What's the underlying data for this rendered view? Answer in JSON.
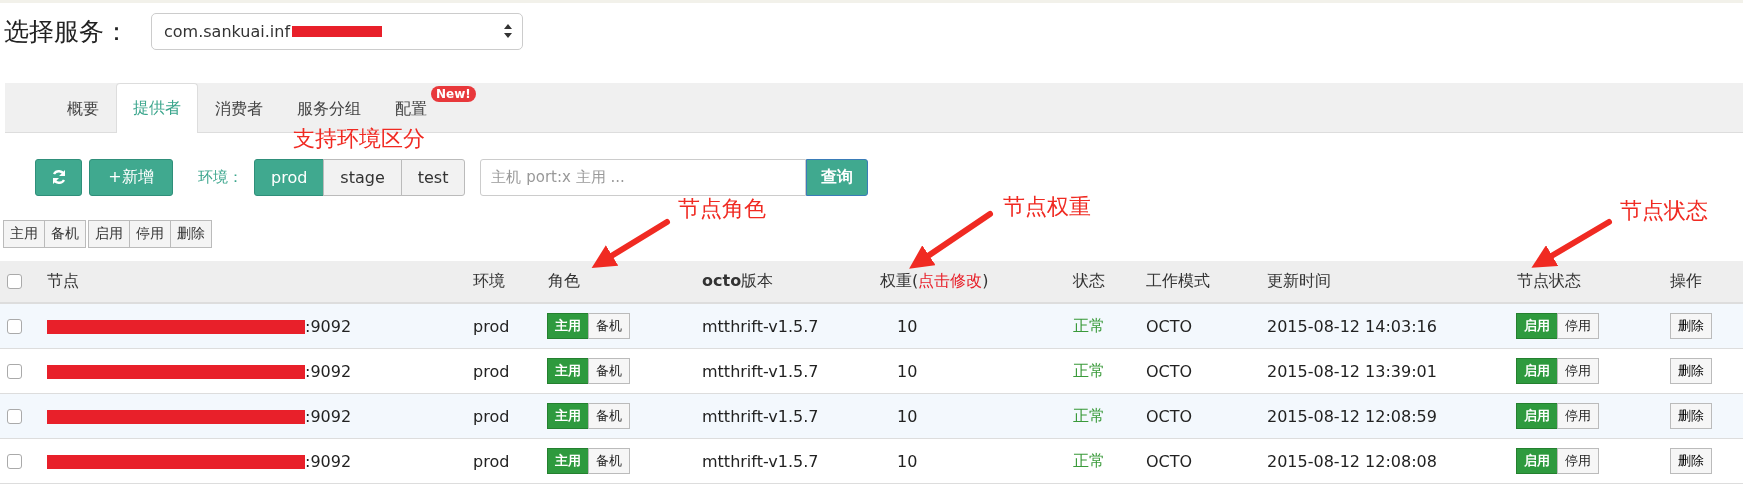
{
  "service_picker": {
    "label": "选择服务：",
    "value": "com.sankuai.inf",
    "redacted": true
  },
  "tabs": [
    {
      "label": "概要",
      "selected": false
    },
    {
      "label": "提供者",
      "selected": true
    },
    {
      "label": "消费者",
      "selected": false
    },
    {
      "label": "服务分组",
      "selected": false
    },
    {
      "label": "配置",
      "selected": false,
      "badge": "New!"
    }
  ],
  "toolbar": {
    "add_label": "+新增",
    "env_label": "环境：",
    "envs": [
      {
        "label": "prod",
        "selected": true
      },
      {
        "label": "stage",
        "selected": false
      },
      {
        "label": "test",
        "selected": false
      }
    ],
    "search": {
      "placeholder": "主机 port:x 主用 ..."
    },
    "query_button": "查询"
  },
  "batch_groups": [
    {
      "buttons": [
        "主用",
        "备机"
      ]
    },
    {
      "buttons": [
        "启用",
        "停用",
        "删除"
      ]
    }
  ],
  "table": {
    "all_checked": false,
    "columns": [
      {
        "label": "节点"
      },
      {
        "label": "环境"
      },
      {
        "label": "角色"
      },
      {
        "label": "**octo**版本"
      },
      {
        "label": "权重(",
        "link": "点击修改",
        "suffix": ")"
      },
      {
        "label": "状态"
      },
      {
        "label": "工作模式"
      },
      {
        "label": "更新时间"
      },
      {
        "label": "节点状态"
      },
      {
        "label": "操作"
      }
    ],
    "rows": [
      {
        "checked": false,
        "redacted": true,
        "node": ":9092",
        "env": "prod",
        "roles": [
          {
            "label": "主用",
            "selected": true
          },
          {
            "label": "备机",
            "selected": false
          }
        ],
        "version": "mtthrift-v1.5.7",
        "weight": "10",
        "status": "正常",
        "mode": "OCTO",
        "updated": "2015-08-12 14:03:16",
        "states": [
          {
            "label": "启用",
            "selected": true
          },
          {
            "label": "停用",
            "selected": false
          }
        ],
        "action": "删除"
      },
      {
        "checked": false,
        "redacted": true,
        "node": ":9092",
        "env": "prod",
        "roles": [
          {
            "label": "主用",
            "selected": true
          },
          {
            "label": "备机",
            "selected": false
          }
        ],
        "version": "mtthrift-v1.5.7",
        "weight": "10",
        "status": "正常",
        "mode": "OCTO",
        "updated": "2015-08-12 13:39:01",
        "states": [
          {
            "label": "启用",
            "selected": true
          },
          {
            "label": "停用",
            "selected": false
          }
        ],
        "action": "删除"
      },
      {
        "checked": false,
        "redacted": true,
        "node": ":9092",
        "env": "prod",
        "roles": [
          {
            "label": "主用",
            "selected": true
          },
          {
            "label": "备机",
            "selected": false
          }
        ],
        "version": "mtthrift-v1.5.7",
        "weight": "10",
        "status": "正常",
        "mode": "OCTO",
        "updated": "2015-08-12 12:08:59",
        "states": [
          {
            "label": "启用",
            "selected": true
          },
          {
            "label": "停用",
            "selected": false
          }
        ],
        "action": "删除"
      },
      {
        "checked": false,
        "redacted": true,
        "node": ":9092",
        "env": "prod",
        "roles": [
          {
            "label": "主用",
            "selected": true
          },
          {
            "label": "备机",
            "selected": false
          }
        ],
        "version": "mtthrift-v1.5.7",
        "weight": "10",
        "status": "正常",
        "mode": "OCTO",
        "updated": "2015-08-12 12:08:08",
        "states": [
          {
            "label": "启用",
            "selected": true
          },
          {
            "label": "停用",
            "selected": false
          }
        ],
        "action": "删除"
      }
    ]
  },
  "annotations": [
    {
      "text": "支持环境区分",
      "arrow": false
    },
    {
      "text": "节点角色",
      "arrow": true
    },
    {
      "text": "节点权重",
      "arrow": true
    },
    {
      "text": "节点状态",
      "arrow": true
    }
  ]
}
